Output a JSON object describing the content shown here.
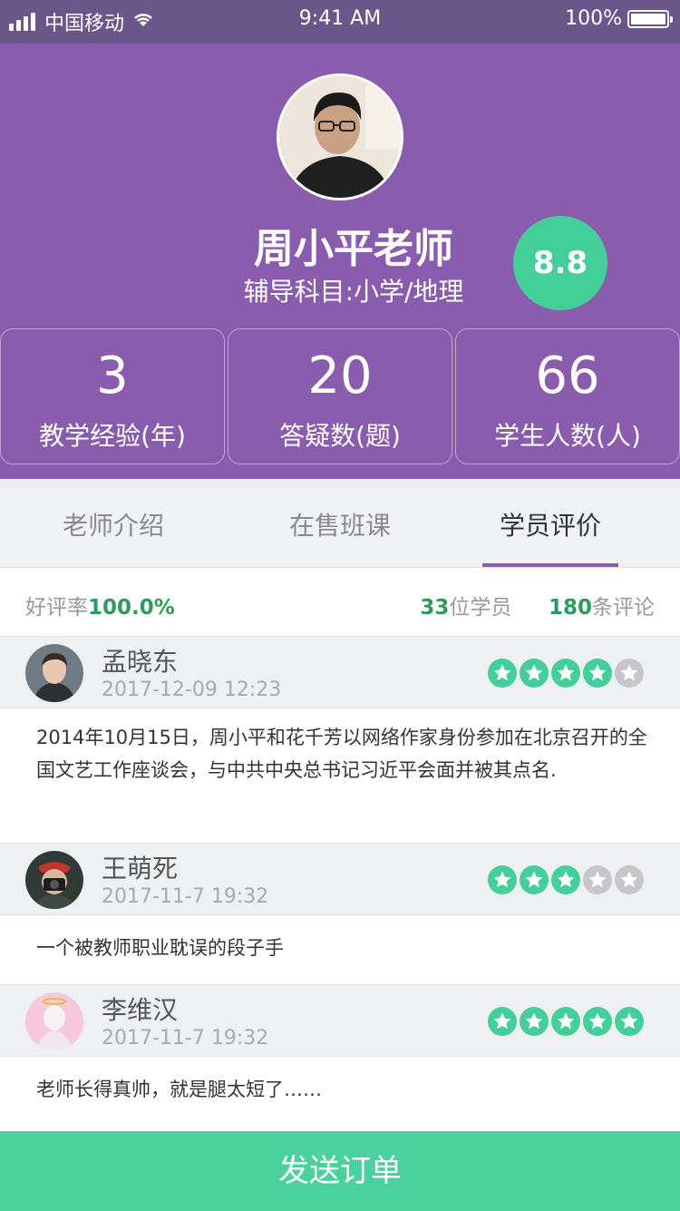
{
  "status_bar": {
    "carrier": "中国移动",
    "time": "9:41 AM",
    "battery": "100%"
  },
  "teacher": {
    "name": "周小平老师",
    "subject": "辅导科目:小学/地理",
    "score": "8.8"
  },
  "stats": [
    {
      "value": "3",
      "label": "教学经验(年)"
    },
    {
      "value": "20",
      "label": "答疑数(题)"
    },
    {
      "value": "66",
      "label": "学生人数(人)"
    }
  ],
  "tabs": [
    {
      "label": "老师介绍"
    },
    {
      "label": "在售班课"
    },
    {
      "label": "学员评价"
    }
  ],
  "active_tab": "学员评价",
  "summary": {
    "rate_label": "好评率",
    "rate_value": "100.0%",
    "students_count": "33",
    "students_label": "位学员",
    "comments_count": "180",
    "comments_label": "条评论"
  },
  "reviews": [
    {
      "name": "孟晓东",
      "date": "2017-12-09 12:23",
      "stars": 4,
      "text": "2014年10月15日，周小平和花千芳以网络作家身份参加在北京召开的全国文艺工作座谈会，与中共中央总书记习近平会面并被其点名."
    },
    {
      "name": "王萌死",
      "date": "2017-11-7 19:32",
      "stars": 3,
      "text": "一个被教师职业耽误的段子手"
    },
    {
      "name": "李维汉",
      "date": "2017-11-7 19:32",
      "stars": 5,
      "text": "老师长得真帅，就是腿太短了……"
    }
  ],
  "bottom_button": {
    "label": "发送订单"
  },
  "colors": {
    "header_purple": "#8a5cad",
    "accent_green": "#44cf9a",
    "star_off": "#c7c7cb",
    "button_green": "#4ad19d"
  }
}
